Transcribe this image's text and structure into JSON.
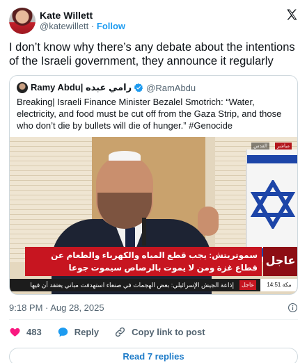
{
  "author": {
    "display_name": "Kate Willett",
    "handle": "@katewillett",
    "separator": "·",
    "follow_label": "Follow"
  },
  "tweet": {
    "text": "I don’t know why there’s any debate about the intentions of the Israeli government, they announce it regularly",
    "timestamp": "9:18 PM · Aug 28, 2025"
  },
  "quote": {
    "display_name": "Ramy Abdu| رامي عبده",
    "handle": "@RamAbdu",
    "text": "Breaking| Israeli Finance Minister Bezalel Smotrich: “Water, electricity, and food must be cut off from the Gaza Strip, and those who don’t die by bullets will die of hunger.” #Genocide",
    "video": {
      "lower_third_line1": "سموتريتش: يجب قطع المياه والكهرباء والطعام عن",
      "lower_third_line2": "قطاع غزة ومن لا يموت بالرصاص سيموت جوعا",
      "breaking_label": "عاجل",
      "ticker_text": "إذاعة الجيش الإسرائيلي: بعض الهجمات في صنعاء استهدفت مباني يعتقد أن فيها",
      "ticker_tag": "عاجل",
      "ticker_time": "14:51",
      "ticker_time_label": "مكة",
      "live_tag": "مباشر",
      "channel_tag": "القدس"
    }
  },
  "actions": {
    "like_count": "483",
    "reply_label": "Reply",
    "copy_link_label": "Copy link to post"
  },
  "read_replies_label": "Read 7 replies",
  "colors": {
    "accent": "#1d9bf0",
    "like": "#f91880",
    "breaking_red": "#c71520"
  },
  "icons": [
    "x-logo-icon",
    "verified-badge-icon",
    "info-icon",
    "heart-icon",
    "reply-bubble-icon",
    "link-icon"
  ]
}
